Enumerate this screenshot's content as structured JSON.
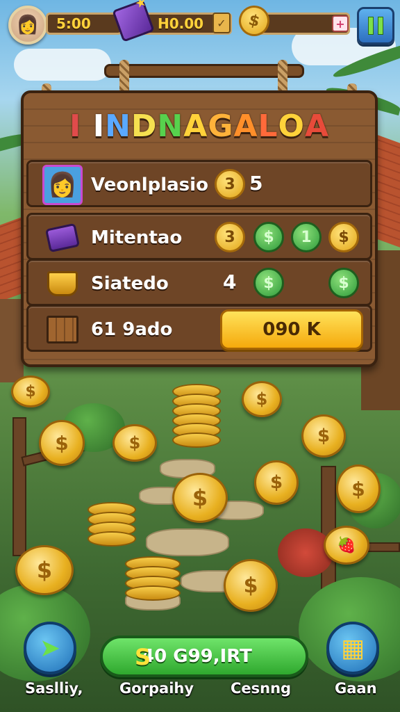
{
  "hud": {
    "timer": "5:00",
    "gem_value": "H0.00",
    "plus_label": "+",
    "coin_symbol": "$",
    "ticket_symbol": "✓"
  },
  "panel": {
    "title_letters": [
      "I",
      " ",
      "I",
      "N",
      "D",
      "N",
      "A",
      "G",
      "A",
      "L",
      "O",
      "A"
    ],
    "title_colors": [
      "#e04b4b",
      "#fff",
      "#ffffff",
      "#5aa9ff",
      "#f5e050",
      "#57d14d",
      "#ffd23a",
      "#ffb23a",
      "#ff8f2a",
      "#ff6a3a",
      "#ffd23a",
      "#e84b3a"
    ],
    "rows": [
      {
        "label": "Veonlplasio",
        "icon": "avatar-icon",
        "value": "5",
        "coins": [
          "3"
        ]
      },
      {
        "label": "Mitentao",
        "icon": "top-hat-icon",
        "coins": [
          "3",
          "$",
          "1",
          "$"
        ]
      },
      {
        "label": "Siatedo",
        "icon": "bucket-icon",
        "value": "4",
        "coins": [
          "$",
          "$"
        ]
      },
      {
        "label": "61 9ado",
        "icon": "crate-icon",
        "button": "090 K"
      }
    ]
  },
  "bottom": {
    "left_label": "Saslliy,",
    "balance_symbol": "S",
    "balance_value": "40 G99,IRT",
    "center_label": "Gorpaihy",
    "center_right_label": "Cesnng",
    "right_label": "Gaan",
    "left_icon": "paper-plane-icon",
    "right_icon": "window-icon"
  },
  "colors": {
    "wood": "#8a5a32",
    "coin_gold": "#e3a618",
    "coin_green": "#2d9a3a",
    "button_green": "#2fa82e",
    "button_blue": "#1f6fb8"
  }
}
